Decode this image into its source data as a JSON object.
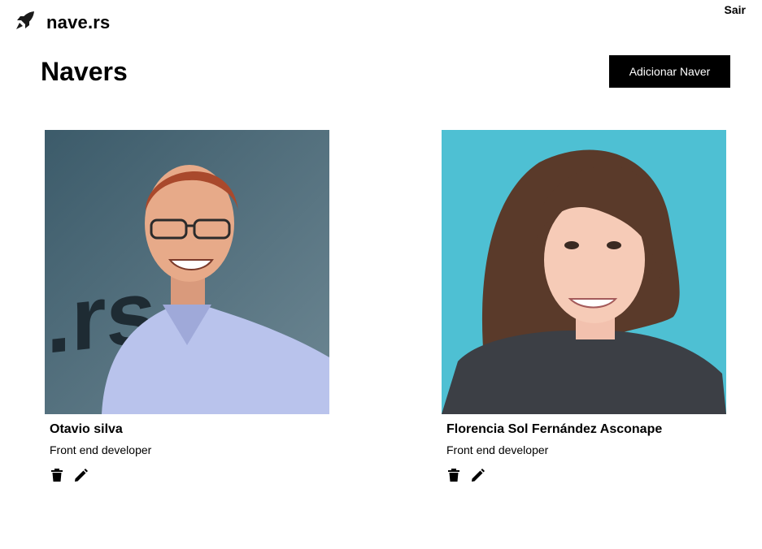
{
  "header": {
    "brand": "nave.rs",
    "logout_label": "Sair",
    "logo_icon": "rocket-icon"
  },
  "main": {
    "title": "Navers",
    "add_button_label": "Adicionar Naver"
  },
  "navers": [
    {
      "name": "Otavio silva",
      "job_role": "Front end developer",
      "actions": [
        "trash-icon",
        "pencil-icon"
      ]
    },
    {
      "name": "Florencia Sol Fernández Asconape",
      "job_role": "Front end developer",
      "actions": [
        "trash-icon",
        "pencil-icon"
      ]
    }
  ],
  "colors": {
    "primary": "#000000",
    "background": "#ffffff",
    "button_text": "#ffffff"
  }
}
